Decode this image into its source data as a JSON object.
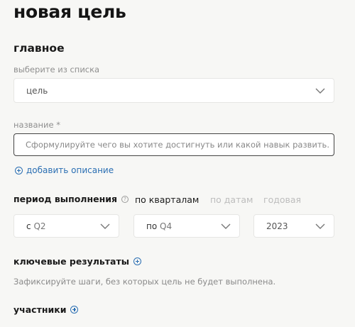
{
  "page": {
    "title": "новая цель"
  },
  "main": {
    "section_title": "главное",
    "goal_type": {
      "label": "выберите из списка",
      "value": "цель"
    },
    "name_field": {
      "label": "название *",
      "placeholder": "Сформулируйте чего вы хотите достигнуть или какой навык развить."
    },
    "add_description": "добавить описание",
    "period": {
      "label": "период выполнения",
      "modes": [
        "по кварталам",
        "по датам",
        "годовая"
      ],
      "active_mode": "по кварталам",
      "from": {
        "prefix": "с",
        "value": "Q2"
      },
      "to": {
        "prefix": "по",
        "value": "Q4"
      },
      "year": "2023"
    },
    "key_results": {
      "label": "ключевые результаты",
      "hint": "Зафиксируйте шаги, без которых цель не будет выполнена."
    },
    "participants": {
      "label": "участники"
    }
  },
  "colors": {
    "background": "#f7f7f5",
    "accent_link": "#2b6fb3",
    "inactive_text": "#bdbdbd"
  },
  "icons": [
    "chevron-down-icon",
    "plus-circle-icon",
    "info-icon"
  ]
}
